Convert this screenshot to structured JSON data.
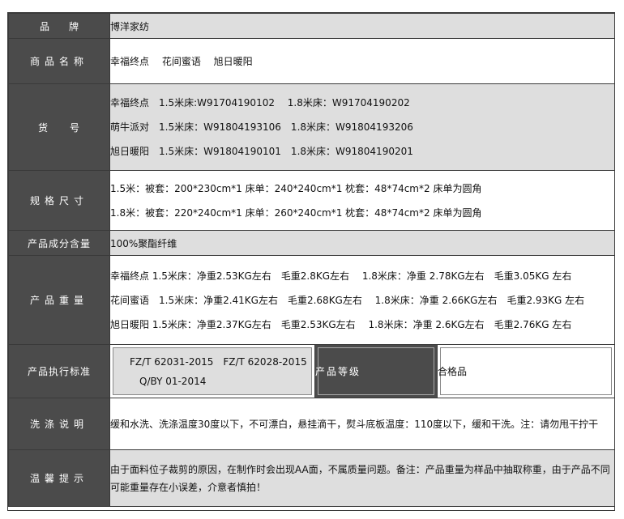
{
  "rows": {
    "brand": {
      "label": "品　　牌",
      "value": "博洋家纺"
    },
    "name": {
      "label": "商品名称",
      "value": "幸福终点　 花间蜜语　 旭日暖阳"
    },
    "sku": {
      "label": "货　　号",
      "lines": [
        "幸福终点　1.5米床:W91704190102　 1.8米床：W91704190202",
        "萌牛派对　1.5米床：W91804193106　1.8米床：W91804193206",
        "旭日暖阳　1.5米床：W91804190101　1.8米床：W91804190201"
      ]
    },
    "size": {
      "label": "规格尺寸",
      "lines": [
        "1.5米：被套：200*230cm*1 床单：240*240cm*1 枕套：48*74cm*2 床单为圆角",
        "1.8米：被套：220*240cm*1 床单：260*240cm*1 枕套：48*74cm*2 床单为圆角"
      ]
    },
    "composition": {
      "label": "产品成分含量",
      "value": "100%聚酯纤维"
    },
    "weight": {
      "label": "产品重量",
      "lines": [
        "幸福终点 1.5米床：净重2.53KG左右　毛重2.8KG左右　 1.8米床：净重 2.78KG左右　毛重3.05KG 左右",
        "花间蜜语　1.5米床：净重2.41KG左右　毛重2.68KG左右　 1.8米床：净重 2.66KG左右　毛重2.93KG 左右",
        "旭日暖阳 1.5米床：净重2.37KG左右　毛重2.53KG左右　 1.8米床：净重 2.6KG左右　毛重2.76KG 左右"
      ]
    },
    "standard": {
      "label": "产品执行标准",
      "lines": [
        "FZ/T 62031-2015　FZ/T 62028-2015",
        "　Q/BY 01-2014"
      ],
      "grade_label": "产品等级",
      "grade_value": "合格品"
    },
    "washing": {
      "label": "洗涤说明",
      "value": "缓和水洗、洗涤温度30度以下，不可漂白，悬挂滴干，熨斗底板温度：110度以下，缓和干洗。注：请勿甩干拧干"
    },
    "tips": {
      "label": "温馨提示",
      "value": "由于面料位子裁剪的原因，在制作时会出现AA面，不属质量问题。备注：产品重量为样品中抽取称重，由于产品不同可能重量存在小误差，介意者慎拍！"
    }
  }
}
